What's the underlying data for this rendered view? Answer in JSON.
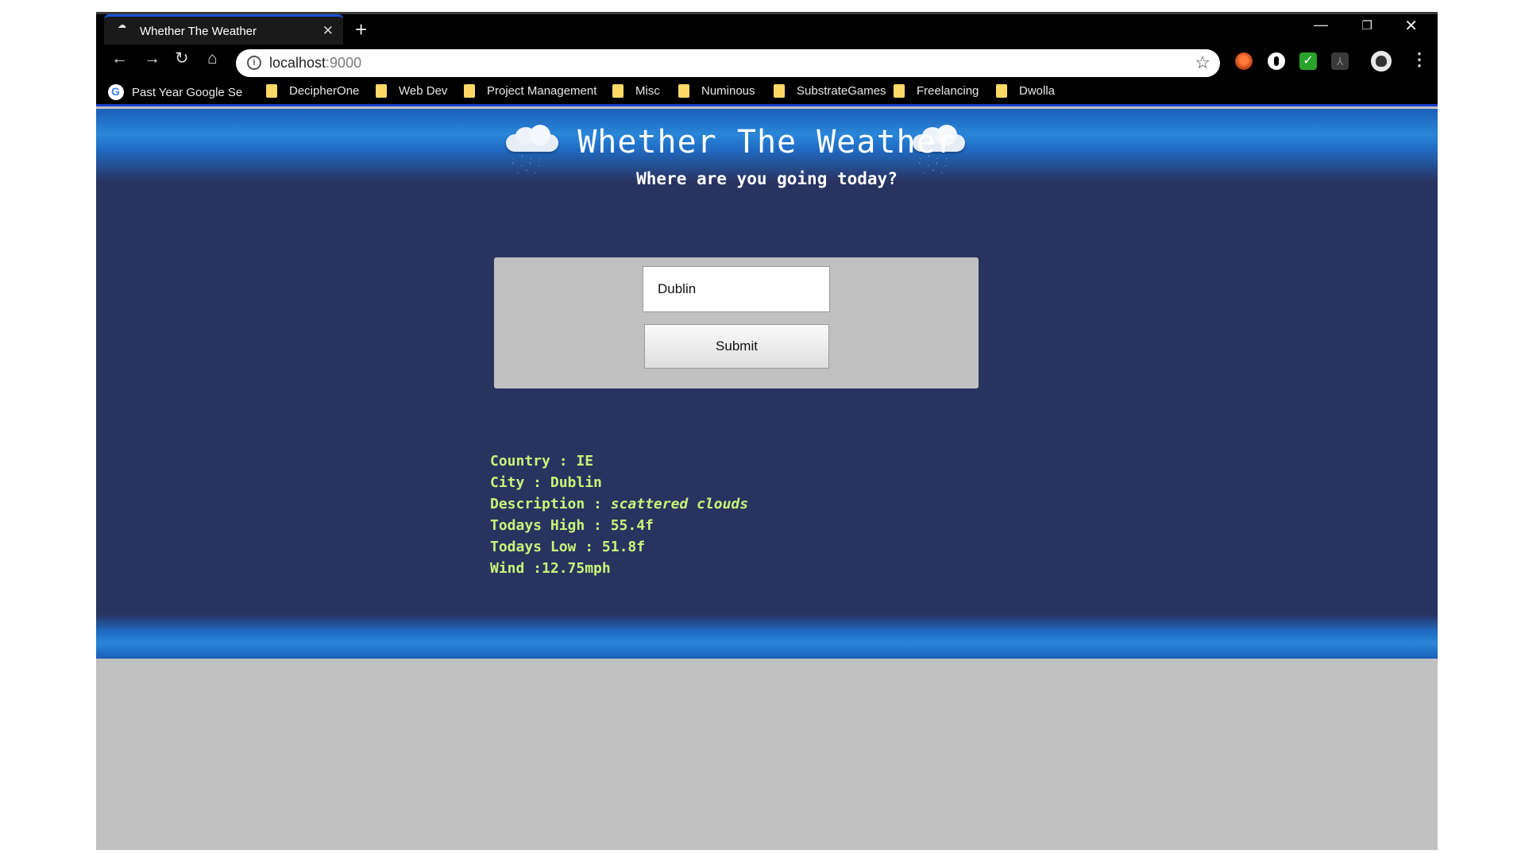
{
  "browser": {
    "tab_title": "Whether The Weather",
    "tab_favicon": "☁",
    "tab_close": "✕",
    "new_tab": "+",
    "window_controls": {
      "minimize": "—",
      "maximize": "❐",
      "close": "✕"
    },
    "nav": {
      "back": "←",
      "forward": "→",
      "reload": "↻",
      "home": "⌂"
    },
    "url_host": "localhost",
    "url_port": ":9000",
    "info_glyph": "i",
    "star_glyph": "☆",
    "menu_glyph": "⋮",
    "extensions": {
      "ext_3_glyph": "✓",
      "ext_4_glyph": "⅄"
    },
    "icons": [
      "site-info-icon",
      "star-icon",
      "ghostery-extension-icon",
      "dark-reader-extension-icon",
      "check-extension-icon",
      "pdf-extension-icon",
      "profile-icon",
      "menu-icon"
    ],
    "bookmarks": [
      {
        "label": "Past Year Google Sea",
        "icon": "google-icon"
      },
      {
        "label": "DecipherOne",
        "icon": "folder-icon"
      },
      {
        "label": "Web Dev",
        "icon": "folder-icon"
      },
      {
        "label": "Project Management",
        "icon": "folder-icon"
      },
      {
        "label": "Misc",
        "icon": "folder-icon"
      },
      {
        "label": "Numinous",
        "icon": "folder-icon"
      },
      {
        "label": "SubstrateGames",
        "icon": "folder-icon"
      },
      {
        "label": "Freelancing",
        "icon": "folder-icon"
      },
      {
        "label": "Dwolla",
        "icon": "folder-icon"
      }
    ]
  },
  "page": {
    "title": "Whether The Weather",
    "subtitle": "Where are you going today?",
    "rain_glyphs": "· ' · ·\n' · ' ·\n · ' ·",
    "form": {
      "city_value": "Dublin",
      "submit_label": "Submit"
    },
    "weather": {
      "country_label": "Country : ",
      "country_value": "IE",
      "city_label": "City : ",
      "city_value": "Dublin",
      "description_label": "Description : ",
      "description_value": "scattered clouds",
      "high_label": "Todays High : ",
      "high_value": "55.4f",
      "low_label": "Todays Low : ",
      "low_value": "51.8f",
      "wind_label": "Wind :",
      "wind_value": "12.75mph"
    }
  },
  "colors": {
    "page_background": "#293360",
    "header_blue": "#2a86d8",
    "weather_text": "#c6f577",
    "form_panel": "#c0c0c0",
    "browser_chrome": "#000000"
  }
}
